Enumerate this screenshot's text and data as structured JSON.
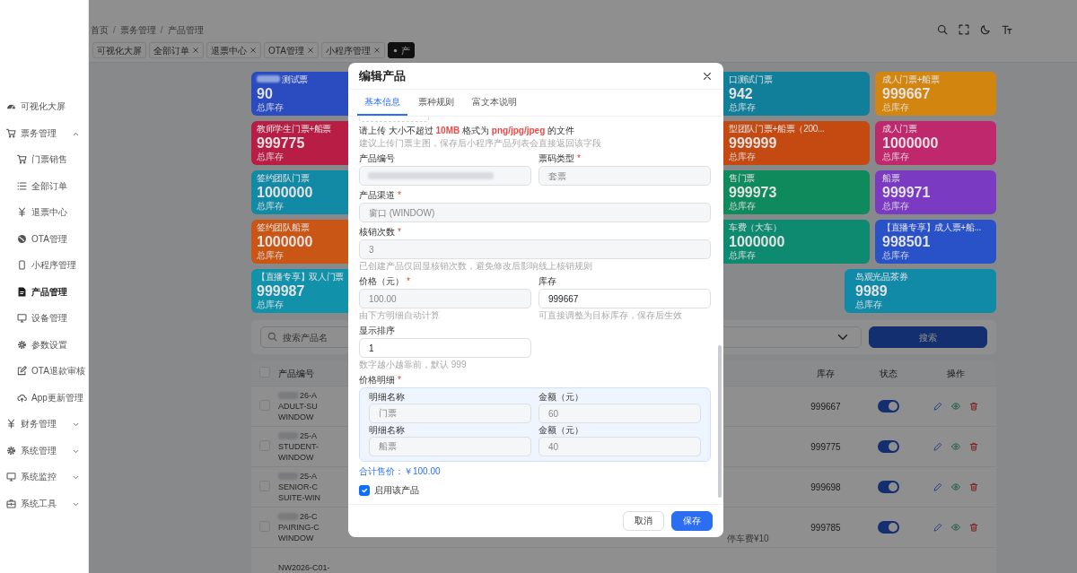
{
  "sidebar": {
    "items": [
      {
        "label": "可视化大屏",
        "selected": false
      },
      {
        "label": "票务管理",
        "selected": false,
        "expanded": true,
        "children": [
          {
            "label": "门票销售",
            "selected": false
          },
          {
            "label": "全部订单",
            "selected": false
          },
          {
            "label": "退票中心",
            "selected": false
          },
          {
            "label": "OTA管理",
            "selected": false
          },
          {
            "label": "小程序管理",
            "selected": false
          },
          {
            "label": "产品管理",
            "selected": true
          },
          {
            "label": "设备管理",
            "selected": false
          },
          {
            "label": "参数设置",
            "selected": false
          },
          {
            "label": "OTA退款审核",
            "selected": false
          },
          {
            "label": "App更新管理",
            "selected": false
          }
        ]
      },
      {
        "label": "财务管理",
        "selected": false,
        "expanded": false
      },
      {
        "label": "系统管理",
        "selected": false,
        "expanded": false
      },
      {
        "label": "系统监控",
        "selected": false,
        "expanded": false
      },
      {
        "label": "系统工具",
        "selected": false,
        "expanded": false
      }
    ]
  },
  "breadcrumb": {
    "separator": "/",
    "items": [
      "首页",
      "票务管理",
      "产品管理"
    ]
  },
  "page_tabs": [
    {
      "label": "可视化大屏",
      "closable": false,
      "selected": false
    },
    {
      "label": "全部订单",
      "closable": true,
      "selected": false
    },
    {
      "label": "退票中心",
      "closable": true,
      "selected": false
    },
    {
      "label": "OTA管理",
      "closable": true,
      "selected": false
    },
    {
      "label": "小程序管理",
      "closable": true,
      "selected": false
    },
    {
      "label": "产",
      "closable": false,
      "selected": true
    }
  ],
  "stat_cards": [
    [
      {
        "title": "测试票",
        "redacted": true,
        "value": "90",
        "caption": "总库存",
        "color": "#2a4cc0"
      },
      {
        "title": "口测试门票",
        "value": "942",
        "caption": "总库存",
        "color": "#117f9a"
      },
      {
        "title": "成人门票+船票",
        "value": "999667",
        "caption": "总库存",
        "color": "#d2860f"
      }
    ],
    [
      {
        "title": "教师学生门票+船票",
        "value": "999775",
        "caption": "总库存",
        "color": "#b81e45"
      },
      {
        "title": "型团队门票+船票（200...",
        "value": "999999",
        "caption": "总库存",
        "color": "#c44a12"
      },
      {
        "title": "成人门票",
        "value": "1000000",
        "caption": "总库存",
        "color": "#c0286e"
      }
    ],
    [
      {
        "title": "签约团队门票",
        "value": "1000000",
        "caption": "总库存",
        "color": "#128aa5"
      },
      {
        "title": "售门票",
        "value": "999973",
        "caption": "总库存",
        "color": "#0f8a5c"
      },
      {
        "title": "船票",
        "value": "999971",
        "caption": "总库存",
        "color": "#7a3bc2"
      }
    ],
    [
      {
        "title": "签约团队船票",
        "value": "1000000",
        "caption": "总库存",
        "color": "#c95614"
      },
      {
        "title": "车费（大车）",
        "value": "1000000",
        "caption": "总库存",
        "color": "#0e8a70"
      },
      {
        "title": "【直播专享】成人票+船...",
        "value": "998501",
        "caption": "总库存",
        "color": "#2a52c8"
      }
    ],
    [
      {
        "title": "【直播专享】双人门票",
        "value": "999987",
        "caption": "总库存",
        "color": "#1192aa"
      },
      {
        "title": "岛观光品茶券",
        "value": "9989",
        "caption": "总库存",
        "color": "#118aa8"
      }
    ]
  ],
  "search": {
    "placeholder": "搜索产品名",
    "button": "搜索"
  },
  "table": {
    "select_all": {
      "checked": false
    },
    "columns": [
      "产品编号",
      "库存",
      "状态",
      "操作"
    ],
    "rows": [
      {
        "checked": false,
        "redacted": true,
        "code_lines": [
          "26-A",
          "ADULT-SU",
          "WINDOW"
        ],
        "stock": "999667",
        "enabled": true
      },
      {
        "checked": false,
        "redacted": true,
        "code_lines": [
          "25-A",
          "STUDENT-",
          "WINDOW"
        ],
        "stock": "999775",
        "enabled": true
      },
      {
        "checked": false,
        "redacted": true,
        "code_lines": [
          "25-A",
          "SENIOR-C",
          "SUITE-WIN"
        ],
        "stock": "999698",
        "enabled": true
      },
      {
        "checked": false,
        "redacted": true,
        "code_lines": [
          "26-C",
          "PAIRING-C",
          "WINDOW"
        ],
        "note": "停车费¥10",
        "stock": "999785",
        "enabled": true
      },
      {
        "code_lines": [
          "NW2026-C01-"
        ]
      }
    ]
  },
  "modal": {
    "title": "编辑产品",
    "required_mark": "*",
    "tabs": [
      {
        "label": "基本信息",
        "selected": true
      },
      {
        "label": "票种规则",
        "selected": false
      },
      {
        "label": "富文本说明",
        "selected": false
      }
    ],
    "upload_hint": "请上传 大小不超过 **10MB** 格式为 **png/jpg/jpeg** 的文件",
    "upload_note": "建议上传门票主图，保存后小程序产品列表会直接返回该字段",
    "field_rows": [
      [
        {
          "label": "产品编号",
          "kind": "input",
          "redacted": true,
          "disabled": true,
          "required": false
        },
        {
          "label": "票码类型",
          "kind": "select",
          "value": "套票",
          "disabled": true,
          "required": true
        }
      ],
      [
        {
          "label": "产品渠道",
          "kind": "select",
          "value": "窗口 (WINDOW)",
          "disabled": true,
          "required": true,
          "wide": true
        }
      ],
      [
        {
          "label": "核销次数",
          "kind": "input",
          "value": "3",
          "disabled": true,
          "required": true,
          "wide": true,
          "help": "已创建产品仅回显核销次数，避免修改后影响线上核销规则"
        }
      ],
      [
        {
          "label": "价格（元）",
          "kind": "input",
          "value": "100.00",
          "disabled": true,
          "required": true,
          "help": "由下方明细自动计算"
        },
        {
          "label": "库存",
          "kind": "input",
          "value": "999667",
          "disabled": false,
          "required": false,
          "help": "可直接调整为目标库存，保存后生效"
        }
      ],
      [
        {
          "label": "显示排序",
          "kind": "input",
          "value": "1",
          "disabled": false,
          "required": false,
          "help": "数字越小越靠前，默认 999"
        }
      ]
    ],
    "price_details": {
      "label": "价格明细",
      "required": true,
      "items": [
        {
          "name_label": "明细名称",
          "name": "门票",
          "amount_label": "金额（元）",
          "amount": "60",
          "disabled": true
        },
        {
          "name_label": "明细名称",
          "name": "船票",
          "amount_label": "金额（元）",
          "amount": "40",
          "disabled": true
        }
      ],
      "total": "合计售价：￥100.00"
    },
    "enable": {
      "label": "启用该产品",
      "checked": true
    },
    "buttons": {
      "cancel": "取消",
      "save": "保存"
    }
  }
}
